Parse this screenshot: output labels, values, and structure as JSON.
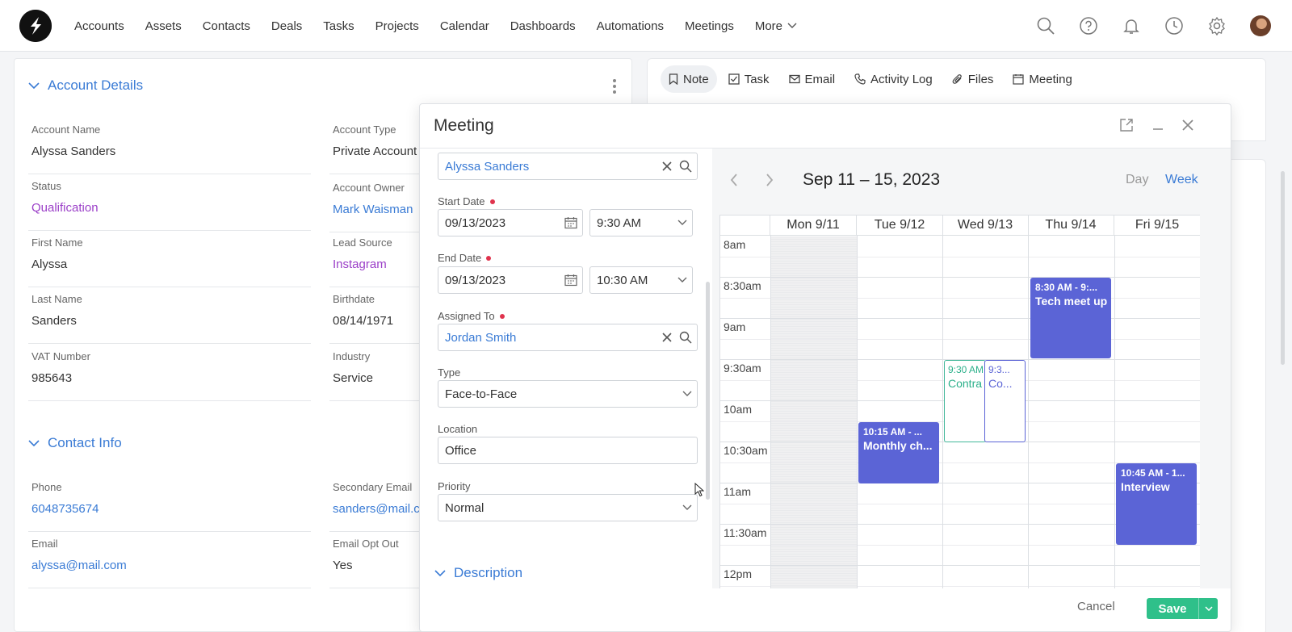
{
  "nav": {
    "items": [
      "Accounts",
      "Assets",
      "Contacts",
      "Deals",
      "Tasks",
      "Projects",
      "Calendar",
      "Dashboards",
      "Automations",
      "Meetings"
    ],
    "more": "More",
    "icons": [
      "search-icon",
      "help-icon",
      "bell-icon",
      "clock-icon",
      "gear-icon"
    ]
  },
  "account": {
    "section_title": "Account Details",
    "fields": [
      {
        "label": "Account Name",
        "value": "Alyssa Sanders"
      },
      {
        "label": "Account Type",
        "value": "Private Account"
      },
      {
        "label": "Status",
        "value": "Qualification"
      },
      {
        "label": "Account Owner",
        "value": "Mark Waisman"
      },
      {
        "label": "First Name",
        "value": "Alyssa"
      },
      {
        "label": "Lead Source",
        "value": "Instagram"
      },
      {
        "label": "Last Name",
        "value": "Sanders"
      },
      {
        "label": "Birthdate",
        "value": "08/14/1971"
      },
      {
        "label": "VAT Number",
        "value": "985643"
      },
      {
        "label": "Industry",
        "value": "Service"
      }
    ]
  },
  "contact": {
    "section_title": "Contact Info",
    "fields": [
      {
        "label": "Phone",
        "value": "6048735674"
      },
      {
        "label": "Secondary Email",
        "value": "sanders@mail.com"
      },
      {
        "label": "Email",
        "value": "alyssa@mail.com"
      },
      {
        "label": "Email Opt Out",
        "value": "Yes"
      }
    ]
  },
  "tabs": [
    "Note",
    "Task",
    "Email",
    "Activity Log",
    "Files",
    "Meeting"
  ],
  "modal": {
    "title": "Meeting",
    "related": "Alyssa Sanders",
    "start_label": "Start Date",
    "start_date": "09/13/2023",
    "start_time": "9:30 AM",
    "end_label": "End Date",
    "end_date": "09/13/2023",
    "end_time": "10:30 AM",
    "assigned_label": "Assigned To",
    "assigned": "Jordan Smith",
    "type_label": "Type",
    "type": "Face-to-Face",
    "location_label": "Location",
    "location": "Office",
    "priority_label": "Priority",
    "priority": "Normal",
    "description_label": "Description",
    "cancel": "Cancel",
    "save": "Save"
  },
  "calendar": {
    "range": "Sep 11 – 15, 2023",
    "view_day": "Day",
    "view_week": "Week",
    "days": [
      "Mon 9/11",
      "Tue 9/12",
      "Wed 9/13",
      "Thu 9/14",
      "Fri 9/15"
    ],
    "times": [
      "8am",
      "8:30am",
      "9am",
      "9:30am",
      "10am",
      "10:30am",
      "11am",
      "11:30am",
      "12pm"
    ],
    "events": [
      {
        "time": "8:30 AM - 9:...",
        "name": "Tech meet up",
        "style": "filled"
      },
      {
        "time": "9:30 AM",
        "name": "Contra",
        "style": "outline-green"
      },
      {
        "time": "9:3...",
        "name": "Co...",
        "style": "outline-blue"
      },
      {
        "time": "10:15 AM - ...",
        "name": "Monthly ch...",
        "style": "filled"
      },
      {
        "time": "10:45 AM - 1...",
        "name": "Interview",
        "style": "filled"
      }
    ]
  },
  "colors": {
    "accent": "#3a7bd5",
    "purple": "#9b3fc8",
    "event": "#5b64d6",
    "save": "#2fc08a",
    "required": "#e0334d"
  }
}
